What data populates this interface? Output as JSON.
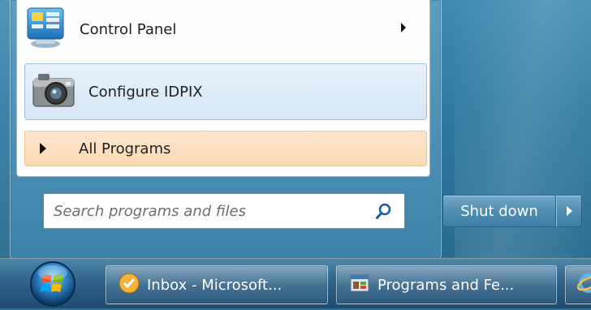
{
  "start_menu": {
    "items": [
      {
        "label": "Control Panel",
        "icon": "control-panel-icon",
        "has_submenu": true
      },
      {
        "label": "Configure IDPIX",
        "icon": "camera-icon",
        "highlighted": true
      }
    ],
    "all_programs": {
      "label": "All Programs",
      "icon": "arrow-right-icon"
    },
    "search": {
      "placeholder": "Search programs and files",
      "icon": "search-icon"
    },
    "shutdown": {
      "label": "Shut down",
      "icon": "arrow-right-icon"
    }
  },
  "taskbar": {
    "start_orb": "windows-logo-icon",
    "buttons": [
      {
        "label": "Inbox - Microsoft...",
        "icon": "outlook-icon"
      },
      {
        "label": "Programs and Fe...",
        "icon": "programs-features-icon"
      },
      {
        "label": "",
        "icon": "ie-icon"
      }
    ]
  },
  "colors": {
    "highlight": "#d5e6f6",
    "all_programs_bg": "#fbd9b4",
    "glass": "#3f8bb0"
  }
}
